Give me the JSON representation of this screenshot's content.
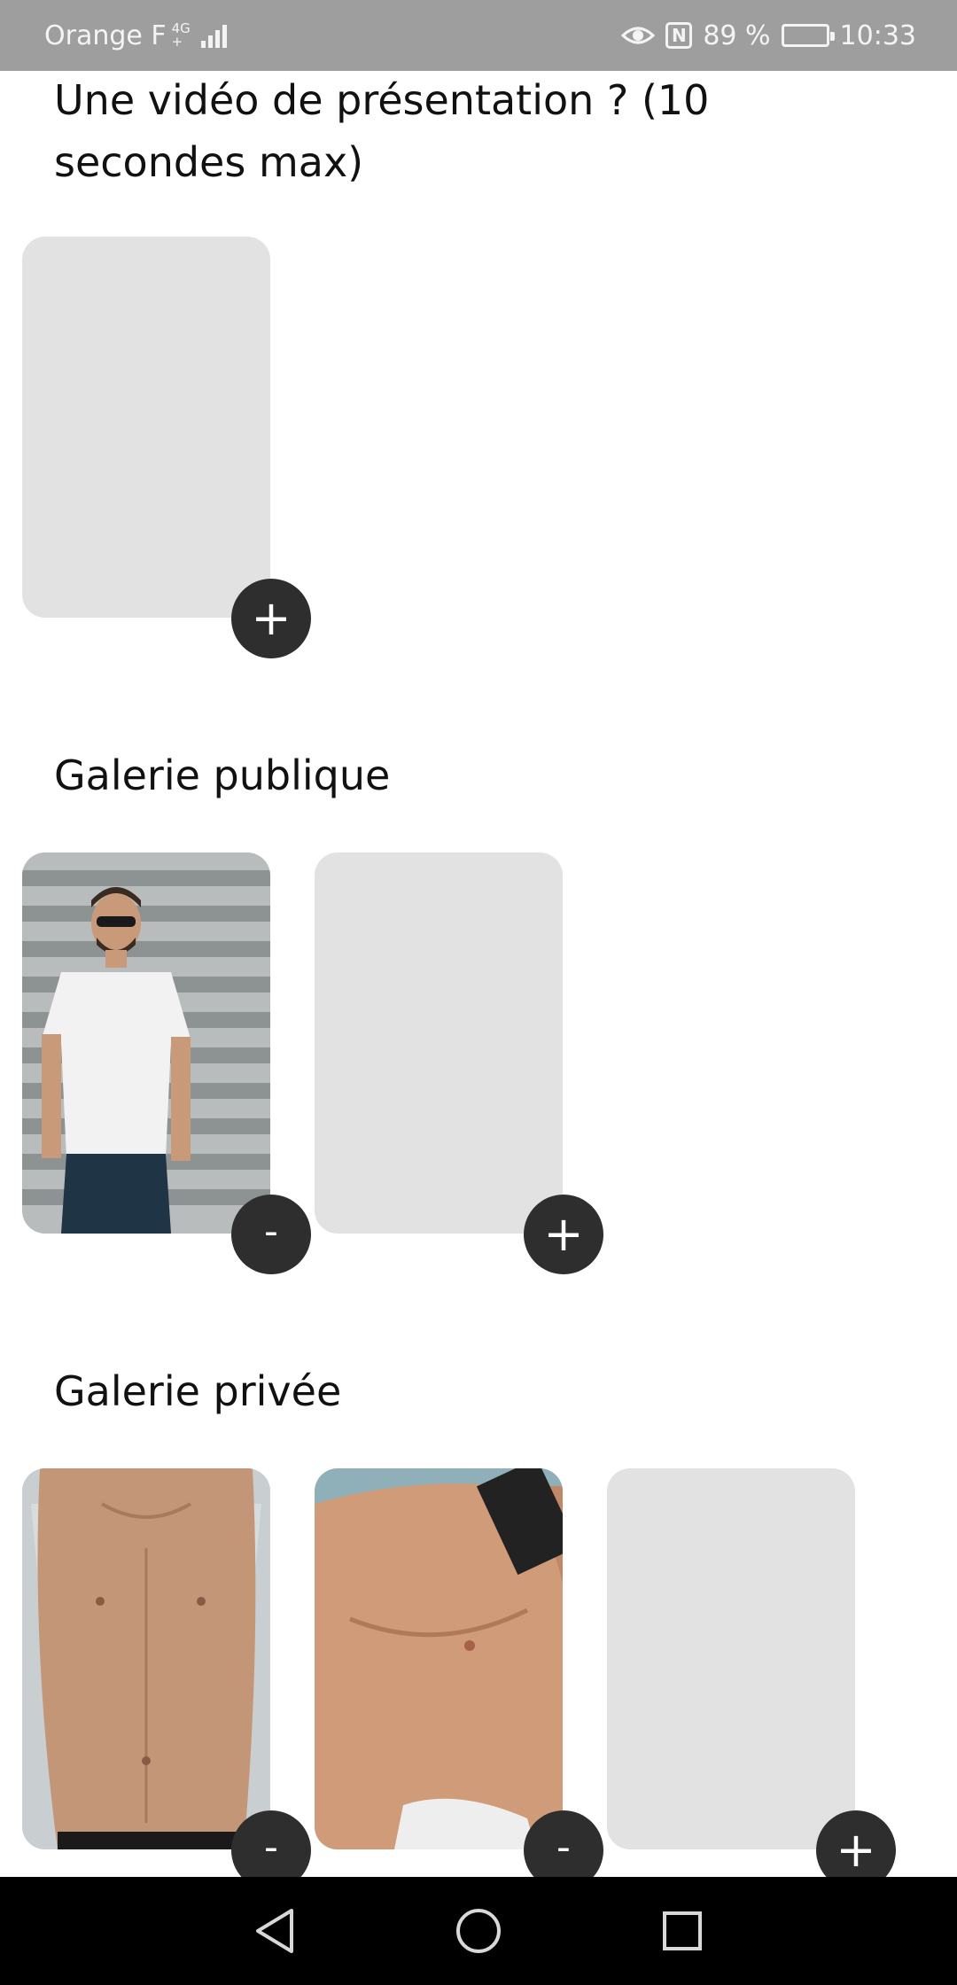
{
  "status_bar": {
    "carrier": "Orange F",
    "network_top": "4G",
    "network_bottom": "+",
    "battery": "89 %",
    "time": "10:33",
    "battery_level": 0.89
  },
  "sections": {
    "video": {
      "title": "Une vidéo de présentation ? (10 secondes max)"
    },
    "public": {
      "title": "Galerie publique"
    },
    "private": {
      "title": "Galerie privée"
    }
  },
  "buttons": {
    "add": "+",
    "remove": "-"
  },
  "icons": {
    "eye": "eye-icon",
    "nfc": "nfc-icon",
    "battery": "battery-icon",
    "signal": "signal-icon",
    "back": "back-icon",
    "home": "home-icon",
    "recents": "recents-icon"
  },
  "colors": {
    "status_bar": "#9e9e9e",
    "tile_placeholder": "#e3e2e3",
    "fab": "#2e2e2e",
    "nav_bar": "#000000"
  }
}
